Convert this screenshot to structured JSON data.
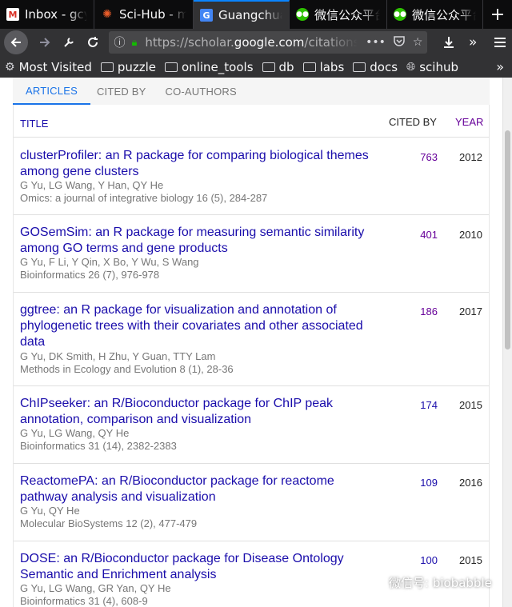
{
  "browser": {
    "tabs": [
      {
        "title": "Inbox - gcy",
        "icon": "gmail-icon",
        "active": false
      },
      {
        "title": "Sci-Hub - m",
        "icon": "scihub-icon",
        "active": false
      },
      {
        "title": "Guangchuang",
        "icon": "google-scholar-icon",
        "active": true
      },
      {
        "title": "微信公众平台",
        "icon": "wechat-icon",
        "active": false
      },
      {
        "title": "微信公众平台",
        "icon": "wechat-icon",
        "active": false
      }
    ],
    "new_tab_symbol": "+",
    "url_prefix": "https://scholar.",
    "url_domain": "google.com",
    "url_suffix": "/citations?user=",
    "page_actions_symbol": "•••",
    "bookmarks": [
      {
        "label": "Most Visited",
        "icon": "gear-icon"
      },
      {
        "label": "puzzle",
        "icon": "folder-icon"
      },
      {
        "label": "online_tools",
        "icon": "folder-icon"
      },
      {
        "label": "db",
        "icon": "folder-icon"
      },
      {
        "label": "labs",
        "icon": "folder-icon"
      },
      {
        "label": "docs",
        "icon": "folder-icon"
      },
      {
        "label": "scihub",
        "icon": "globe-icon"
      }
    ]
  },
  "scholar": {
    "tabs": [
      "ARTICLES",
      "CITED BY",
      "CO-AUTHORS"
    ],
    "table_header": {
      "title": "TITLE",
      "cited_by": "CITED BY",
      "year": "YEAR"
    },
    "rows": [
      {
        "title": "clusterProfiler: an R package for comparing biological themes among gene clusters",
        "authors": "G Yu, LG Wang, Y Han, QY He",
        "venue": "Omics: a journal of integrative biology 16 (5), 284-287",
        "cited_by": "763",
        "year": "2012"
      },
      {
        "title": "GOSemSim: an R package for measuring semantic similarity among GO terms and gene products",
        "authors": "G Yu, F Li, Y Qin, X Bo, Y Wu, S Wang",
        "venue": "Bioinformatics 26 (7), 976-978",
        "cited_by": "401",
        "year": "2010"
      },
      {
        "title": "ggtree: an R package for visualization and annotation of phylogenetic trees with their covariates and other associated data",
        "authors": "G Yu, DK Smith, H Zhu, Y Guan, TTY Lam",
        "venue": "Methods in Ecology and Evolution 8 (1), 28-36",
        "cited_by": "186",
        "year": "2017"
      },
      {
        "title": "ChIPseeker: an R/Bioconductor package for ChIP peak annotation, comparison and visualization",
        "authors": "G Yu, LG Wang, QY He",
        "venue": "Bioinformatics 31 (14), 2382-2383",
        "cited_by": "174",
        "year": "2015"
      },
      {
        "title": "ReactomePA: an R/Bioconductor package for reactome pathway analysis and visualization",
        "authors": "G Yu, QY He",
        "venue": "Molecular BioSystems 12 (2), 477-479",
        "cited_by": "109",
        "year": "2016"
      },
      {
        "title": "DOSE: an R/Bioconductor package for Disease Ontology Semantic and Enrichment analysis",
        "authors": "G Yu, LG Wang, GR Yan, QY He",
        "venue": "Bioinformatics 31 (4), 608-9",
        "cited_by": "100",
        "year": "2015"
      }
    ]
  },
  "watermark": "微信号: biobabble",
  "colors": {
    "link": "#1a0dab",
    "visited": "#660099",
    "accent": "#1a73e8",
    "chrome": "#323234"
  }
}
